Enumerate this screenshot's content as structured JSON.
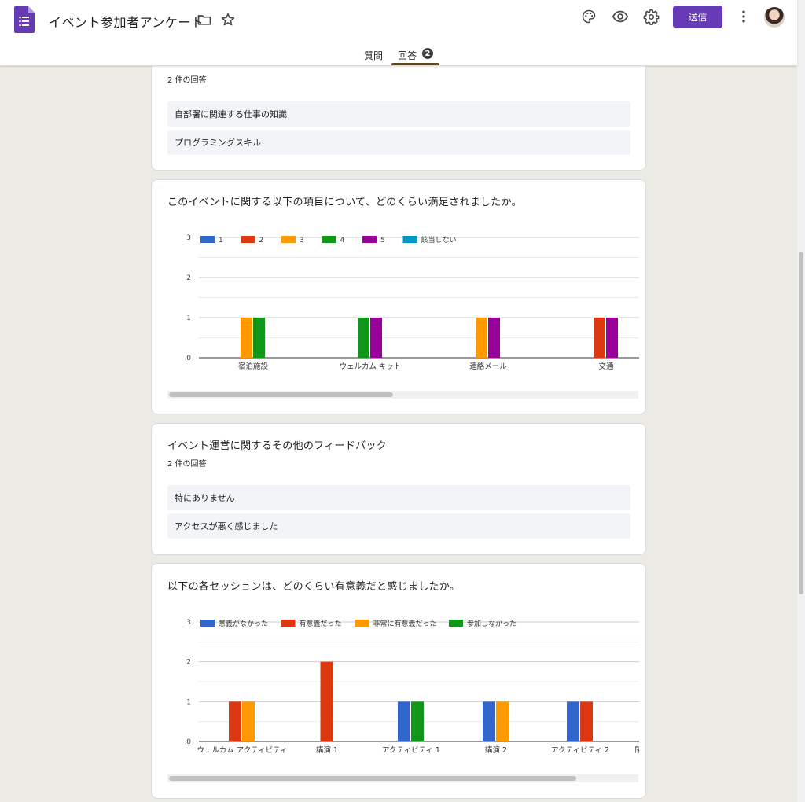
{
  "header": {
    "title": "イベント参加者アンケート",
    "send_label": "送信",
    "tabs": {
      "questions": "質問",
      "responses": "回答",
      "responses_count": "2"
    },
    "icons": [
      "forms-logo-icon",
      "folder-icon",
      "star-icon",
      "palette-icon",
      "eye-icon",
      "gear-icon",
      "more-vert-icon",
      "avatar"
    ]
  },
  "card1": {
    "count": "2 件の回答",
    "responses": [
      "自部署に関連する仕事の知識",
      "プログラミングスキル"
    ]
  },
  "card2": {
    "title": "このイベントに関する以下の項目について、どのくらい満足されましたか。"
  },
  "card3": {
    "title": "イベント運営に関するその他のフィードバック",
    "count": "2 件の回答",
    "responses": [
      "特にありません",
      "アクセスが悪く感じました"
    ]
  },
  "card4": {
    "title": "以下の各セッションは、どのくらい有意義だと感じましたか。"
  },
  "colors": {
    "accent": "#673ab7",
    "blue": "#3366cc",
    "red": "#dc3912",
    "orange": "#ff9900",
    "green": "#109618",
    "purple": "#990099",
    "teal": "#0099c6"
  },
  "chart_data": [
    {
      "type": "bar",
      "ylim": [
        0,
        3
      ],
      "yticks": [
        0,
        1,
        2,
        3
      ],
      "legend_position": "top-left",
      "categories": [
        "宿泊施設",
        "ウェルカム キット",
        "連絡メール",
        "交通"
      ],
      "series": [
        {
          "name": "1",
          "color": "#3366cc",
          "values": [
            0,
            0,
            0,
            0
          ]
        },
        {
          "name": "2",
          "color": "#dc3912",
          "values": [
            0,
            0,
            0,
            1
          ]
        },
        {
          "name": "3",
          "color": "#ff9900",
          "values": [
            1,
            0,
            1,
            0
          ]
        },
        {
          "name": "4",
          "color": "#109618",
          "values": [
            1,
            1,
            0,
            0
          ]
        },
        {
          "name": "5",
          "color": "#990099",
          "values": [
            0,
            1,
            1,
            1
          ]
        },
        {
          "name": "該当しない",
          "color": "#0099c6",
          "values": [
            0,
            0,
            0,
            0
          ]
        }
      ]
    },
    {
      "type": "bar",
      "ylim": [
        0,
        3
      ],
      "yticks": [
        0,
        1,
        2,
        3
      ],
      "legend_position": "top-left",
      "categories": [
        "ウェルカム アクティビティ",
        "講演 1",
        "アクティビティ 1",
        "講演 2",
        "アクティビティ 2",
        "閉会"
      ],
      "series": [
        {
          "name": "意義がなかった",
          "color": "#3366cc",
          "values": [
            0,
            0,
            1,
            1,
            1,
            0
          ]
        },
        {
          "name": "有意義だった",
          "color": "#dc3912",
          "values": [
            1,
            2,
            0,
            0,
            1,
            0
          ]
        },
        {
          "name": "非常に有意義だった",
          "color": "#ff9900",
          "values": [
            1,
            0,
            0,
            1,
            0,
            0
          ]
        },
        {
          "name": "参加しなかった",
          "color": "#109618",
          "values": [
            0,
            0,
            1,
            0,
            0,
            0
          ]
        }
      ]
    }
  ]
}
